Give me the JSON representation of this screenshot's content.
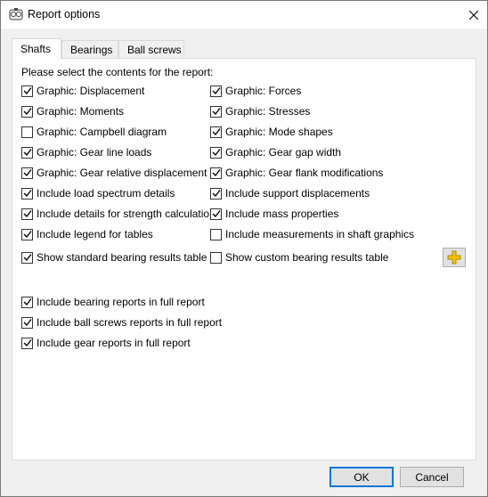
{
  "window": {
    "title": "Report options"
  },
  "tabs": [
    "Shafts",
    "Bearings",
    "Ball screws"
  ],
  "active_tab": "Shafts",
  "panel": {
    "intro": "Please select the contents for the report:",
    "left_column": [
      {
        "label": "Graphic: Displacement",
        "checked": true
      },
      {
        "label": "Graphic: Moments",
        "checked": true
      },
      {
        "label": "Graphic: Campbell diagram",
        "checked": false
      },
      {
        "label": "Graphic: Gear line loads",
        "checked": true
      },
      {
        "label": "Graphic: Gear relative displacement",
        "checked": true
      },
      {
        "label": "Include load spectrum details",
        "checked": true
      },
      {
        "label": "Include details for strength calculation",
        "checked": true
      },
      {
        "label": "Include legend for tables",
        "checked": true
      },
      {
        "label": "Show standard bearing results table",
        "checked": true
      }
    ],
    "right_column": [
      {
        "label": "Graphic: Forces",
        "checked": true
      },
      {
        "label": "Graphic: Stresses",
        "checked": true
      },
      {
        "label": "Graphic: Mode shapes",
        "checked": true
      },
      {
        "label": "Graphic: Gear gap width",
        "checked": true
      },
      {
        "label": "Graphic: Gear flank modifications",
        "checked": true
      },
      {
        "label": "Include support displacements",
        "checked": true
      },
      {
        "label": "Include mass properties",
        "checked": true
      },
      {
        "label": "Include measurements in shaft graphics",
        "checked": false
      },
      {
        "label": "Show custom bearing results table",
        "checked": false
      }
    ],
    "bottom_options": [
      {
        "label": "Include bearing reports in full report",
        "checked": true
      },
      {
        "label": "Include ball screws reports in full report",
        "checked": true
      },
      {
        "label": "Include gear reports in full report",
        "checked": true
      }
    ]
  },
  "buttons": {
    "ok": "OK",
    "cancel": "Cancel"
  },
  "icons": {
    "app": "report-app-icon",
    "close": "close-icon",
    "add": "plus-icon"
  },
  "colors": {
    "accent": "#0078d7",
    "plus_fill": "#f5c400",
    "plus_stroke": "#b08a00"
  }
}
